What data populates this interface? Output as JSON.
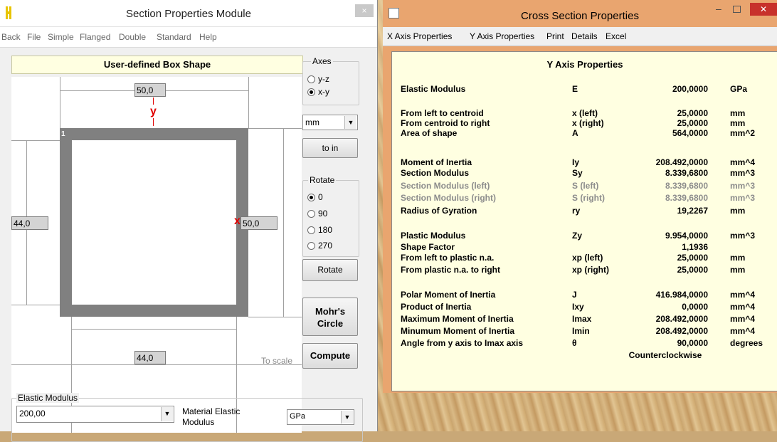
{
  "left_window": {
    "title": "Section Properties Module",
    "close_glyph": "×",
    "menu": [
      "Back",
      "File",
      "Simple",
      "Flanged",
      "Double",
      "Standard",
      "Help"
    ],
    "shape_title": "User-defined Box Shape",
    "drawing": {
      "dim_top": "50,0",
      "dim_bottom": "44,0",
      "dim_left": "44,0",
      "dim_right": "50,0",
      "y_axis_label": "y",
      "x_axis_label": "x",
      "shape_number": "1",
      "scale_note": "To scale"
    },
    "axes": {
      "title": "Axes",
      "options": [
        "y-z",
        "x-y"
      ],
      "selected": "x-y"
    },
    "units_select": {
      "value": "mm"
    },
    "to_in_button": "to in",
    "rotate": {
      "title": "Rotate",
      "options": [
        "0",
        "90",
        "180",
        "270"
      ],
      "selected": "0"
    },
    "rotate_button": "Rotate",
    "mohr_button": {
      "line1": "Mohr's",
      "line2": "Circle"
    },
    "compute_button": "Compute",
    "elastic": {
      "title": "Elastic Modulus",
      "value": "200,00",
      "material_label": "Material Elastic Modulus",
      "unit": "GPa"
    }
  },
  "right_window": {
    "title": "Cross Section Properties",
    "controls": {
      "minimize": "–",
      "close": "✕"
    },
    "menu": [
      "X Axis Properties",
      "Y Axis Properties",
      "Print",
      "Details",
      "Excel"
    ],
    "panel_title": "Y Axis Properties",
    "rows": [
      {
        "label": "Elastic Modulus",
        "sym": "E",
        "val": "200,0000",
        "unit": "GPa"
      },
      {
        "label": "From left to centroid",
        "sym": "x (left)",
        "val": "25,0000",
        "unit": "mm"
      },
      {
        "label": "From centroid to right",
        "sym": "x (right)",
        "val": "25,0000",
        "unit": "mm"
      },
      {
        "label": "Area of shape",
        "sym": "A",
        "val": "564,0000",
        "unit": "mm^2"
      },
      {
        "label": "Moment of Inertia",
        "sym": "Iy",
        "val": "208.492,0000",
        "unit": "mm^4"
      },
      {
        "label": "Section Modulus",
        "sym": "Sy",
        "val": "8.339,6800",
        "unit": "mm^3"
      },
      {
        "label": "Section Modulus (left)",
        "sym": "S (left)",
        "val": "8.339,6800",
        "unit": "mm^3"
      },
      {
        "label": "Section Modulus (right)",
        "sym": "S (right)",
        "val": "8.339,6800",
        "unit": "mm^3"
      },
      {
        "label": "Radius of Gyration",
        "sym": "ry",
        "val": "19,2267",
        "unit": "mm"
      },
      {
        "label": "Plastic Modulus",
        "sym": "Zy",
        "val": "9.954,0000",
        "unit": "mm^3"
      },
      {
        "label": "Shape Factor",
        "sym": "",
        "val": "1,1936",
        "unit": ""
      },
      {
        "label": "From left to plastic n.a.",
        "sym": "xp (left)",
        "val": "25,0000",
        "unit": "mm"
      },
      {
        "label": "From plastic n.a. to right",
        "sym": "xp (right)",
        "val": "25,0000",
        "unit": "mm"
      },
      {
        "label": "Polar Moment of Inertia",
        "sym": "J",
        "val": "416.984,0000",
        "unit": "mm^4"
      },
      {
        "label": "Product of Inertia",
        "sym": "Ixy",
        "val": "0,0000",
        "unit": "mm^4"
      },
      {
        "label": "Maximum Moment of Inertia",
        "sym": "Imax",
        "val": "208.492,0000",
        "unit": "mm^4"
      },
      {
        "label": "Minumum Moment of Inertia",
        "sym": "Imin",
        "val": "208.492,0000",
        "unit": "mm^4"
      },
      {
        "label": "Angle from y axis to Imax axis",
        "sym": "θ",
        "val": "90,0000",
        "unit": "degrees"
      }
    ],
    "direction_note": "Counterclockwise"
  }
}
